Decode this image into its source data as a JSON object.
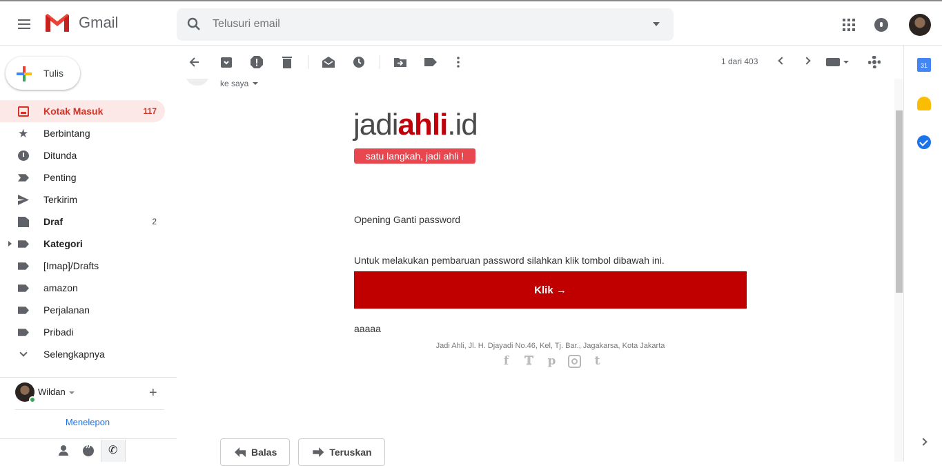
{
  "app": {
    "name": "Gmail",
    "brand_colors": {
      "red": "#EA4335",
      "blue": "#4285F4",
      "yellow": "#FBBC04",
      "green": "#34A853"
    }
  },
  "header": {
    "search_placeholder": "Telusuri email"
  },
  "compose": {
    "label": "Tulis"
  },
  "sidebar": {
    "items": [
      {
        "label": "Kotak Masuk",
        "count": "117",
        "icon": "inbox-icon",
        "active": true
      },
      {
        "label": "Berbintang",
        "count": "",
        "icon": "star-icon"
      },
      {
        "label": "Ditunda",
        "count": "",
        "icon": "clock-icon"
      },
      {
        "label": "Penting",
        "count": "",
        "icon": "important-icon"
      },
      {
        "label": "Terkirim",
        "count": "",
        "icon": "send-icon"
      },
      {
        "label": "Draf",
        "count": "2",
        "icon": "draft-icon"
      },
      {
        "label": "Kategori",
        "count": "",
        "icon": "label-icon"
      },
      {
        "label": "[Imap]/Drafts",
        "count": "",
        "icon": "label-icon"
      },
      {
        "label": "amazon",
        "count": "",
        "icon": "label-icon"
      },
      {
        "label": "Perjalanan",
        "count": "",
        "icon": "label-icon"
      },
      {
        "label": "Pribadi",
        "count": "",
        "icon": "label-icon"
      },
      {
        "label": "Selengkapnya",
        "count": "",
        "icon": "chevron-down-icon"
      }
    ]
  },
  "hangouts": {
    "user_name": "Wildan",
    "call_link": "Menelepon"
  },
  "toolbar": {
    "pager": "1 dari 403"
  },
  "message": {
    "recipient": "ke saya",
    "brand_prefix": "jadi",
    "brand_highlight": "ahli",
    "brand_suffix": ".id",
    "tagline": "satu langkah, jadi ahli !",
    "line1": "Opening Ganti password",
    "line2": "Untuk melakukan pembaruan password silahkan klik tombol dibawah ini.",
    "cta_label": "Klik →",
    "cta_color": "#C00000",
    "line3": "aaaaa",
    "footer_address": "Jadi Ahli, Jl. H. Djayadi No.46, Kel, Tj. Bar., Jagakarsa, Kota Jakarta",
    "socials": [
      "facebook-icon",
      "twitter-icon",
      "pinterest-icon",
      "instagram-icon",
      "tumblr-icon"
    ]
  },
  "actions": {
    "reply_label": "Balas",
    "forward_label": "Teruskan"
  },
  "right_panel": {
    "calendar_day": "31"
  }
}
